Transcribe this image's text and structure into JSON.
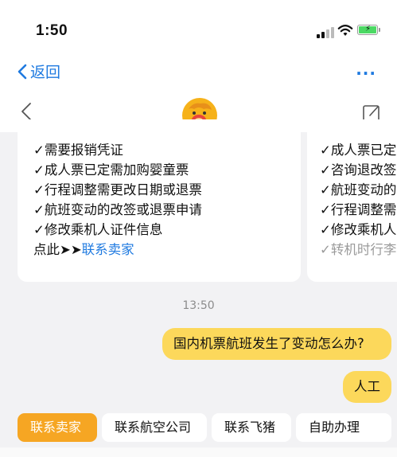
{
  "status_bar": {
    "time": "1:50"
  },
  "nav": {
    "back_label": "返回",
    "more_label": "···"
  },
  "chat": {
    "card1": {
      "lines": [
        "✓需要报销凭证",
        "✓成人票已定需加购婴童票",
        "✓行程调整需更改日期或退票",
        "✓航班变动的改签或退票申请",
        "✓修改乘机人证件信息"
      ],
      "footer_prefix": "点此➤➤",
      "footer_link": "联系卖家"
    },
    "card2": {
      "lines": [
        "✓成人票已定",
        "✓咨询退改签",
        "✓航班变动的",
        "✓行程调整需",
        "✓修改乘机人",
        "✓转机时行李"
      ]
    },
    "timestamp": "13:50",
    "messages": [
      {
        "text": "国内机票航班发生了变动怎么办?"
      },
      {
        "text": "人工"
      }
    ]
  },
  "quick_replies": [
    "联系卖家",
    "联系航空公司",
    "联系飞猪",
    "自助办理"
  ],
  "colors": {
    "accent": "#1f7ae0",
    "bubble": "#fcd85b",
    "primary_chip": "#f6a623"
  }
}
